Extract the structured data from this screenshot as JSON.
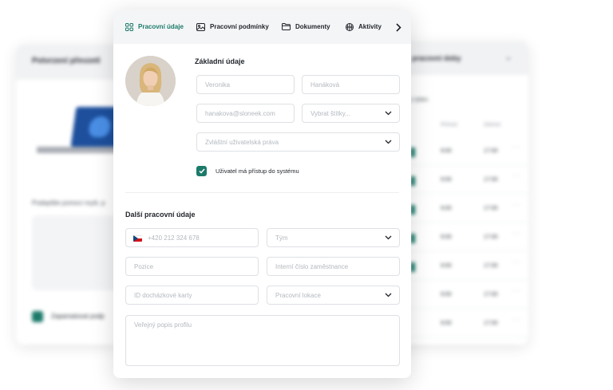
{
  "background": {
    "left_panel": {
      "title": "Potvrzení převzetí",
      "sign_text": "Podepište pomocí myši, p",
      "remember_label": "Zapamatovat podp"
    },
    "right_panel": {
      "title": "pracovní doby",
      "subtitle": "ý týden",
      "col_arrival": "Příchod",
      "col_departure": "Odchod",
      "rows": [
        {
          "arrival": "9:00",
          "departure": "17:00"
        },
        {
          "arrival": "9:00",
          "departure": "17:00"
        },
        {
          "arrival": "9:00",
          "departure": "17:00"
        },
        {
          "arrival": "9:00",
          "departure": "17:00"
        },
        {
          "arrival": "9:00",
          "departure": "17:00"
        },
        {
          "arrival": "9:00",
          "departure": "17:00"
        },
        {
          "arrival": "9:00",
          "departure": "17:00"
        }
      ]
    }
  },
  "tabs": [
    {
      "label": "Pracovní údaje",
      "icon": "grid-icon",
      "active": true
    },
    {
      "label": "Pracovní podmínky",
      "icon": "image-icon",
      "active": false
    },
    {
      "label": "Dokumenty",
      "icon": "folder-icon",
      "active": false
    },
    {
      "label": "Aktivity",
      "icon": "basketball-icon",
      "active": false
    }
  ],
  "basic": {
    "title": "Základní údaje",
    "first_name": "Veronika",
    "last_name": "Hanáková",
    "email": "hanakova@sloneek.com",
    "tags_placeholder": "Vybrat štítky...",
    "rights_placeholder": "Zvláštní uživatelská práva",
    "access_label": "Uživatel má přístup do systému",
    "access_checked": true
  },
  "extra": {
    "title": "Další pracovní údaje",
    "phone": "+420 212 324 678",
    "team_placeholder": "Tým",
    "position_placeholder": "Pozice",
    "employee_id_placeholder": "Interní číslo zaměstnance",
    "attendance_card_placeholder": "ID docházkové karty",
    "location_placeholder": "Pracovní lokace",
    "public_profile_placeholder": "Veřejný popis profilu"
  },
  "colors": {
    "accent": "#1b7a6a",
    "text": "#1f2329",
    "placeholder": "#b3b8be",
    "border": "#dde0e4",
    "tab_bg": "#f4f5f7"
  }
}
